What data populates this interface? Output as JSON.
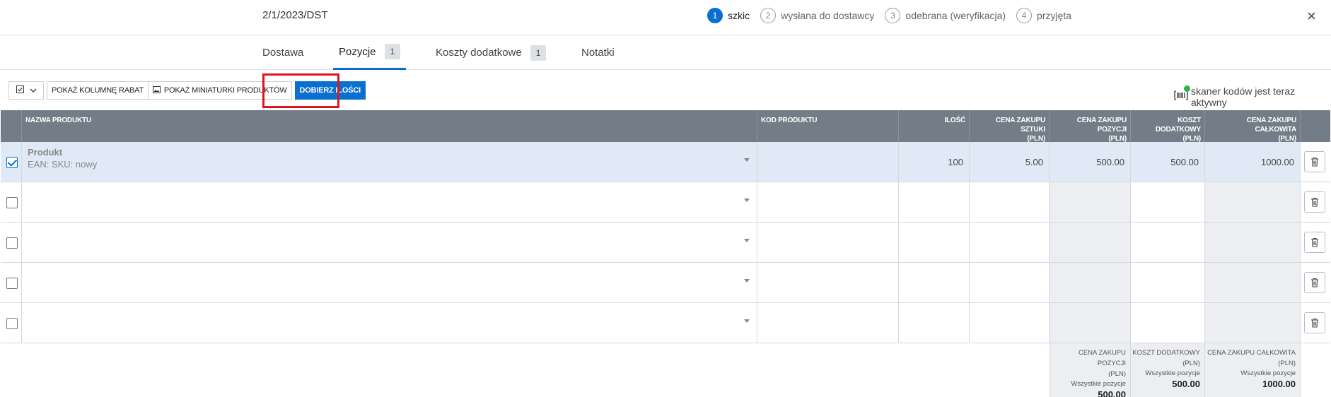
{
  "header": {
    "title": "2/1/2023/DST",
    "steps": [
      {
        "num": "1",
        "label": "szkic"
      },
      {
        "num": "2",
        "label": "wysłana do dostawcy"
      },
      {
        "num": "3",
        "label": "odebrana (weryfikacja)"
      },
      {
        "num": "4",
        "label": "przyjęta"
      }
    ],
    "active_step": "1",
    "close": "×"
  },
  "tabs": [
    {
      "label": "Dostawa",
      "badge": ""
    },
    {
      "label": "Pozycje",
      "badge": "1"
    },
    {
      "label": "Koszty dodatkowe",
      "badge": "1"
    },
    {
      "label": "Notatki",
      "badge": ""
    }
  ],
  "active_tab": "Pozycje",
  "toolbar": {
    "show_discount": "POKAŻ KOLUMNĘ RABAT",
    "show_thumbnails": "POKAŻ MINIATURKI PRODUKTÓW",
    "pick_quantities": "DOBIERZ ILOŚCI",
    "scanner_status": "skaner kodów jest teraz aktywny"
  },
  "columns": {
    "name": "NAZWA PRODUKTU",
    "code": "KOD PRODUKTU",
    "qty": "ILOŚĆ",
    "unit_price_1": "CENA ZAKUPU SZTUKI",
    "unit_price_2": "(PLN)",
    "pos_price_1": "CENA ZAKUPU POZYCJI",
    "pos_price_2": "(PLN)",
    "extra_1": "KOSZT DODATKOWY",
    "extra_2": "(PLN)",
    "total_1": "CENA ZAKUPU CAŁKOWITA",
    "total_2": "(PLN)"
  },
  "rows": [
    {
      "checked": true,
      "name": "Produkt",
      "meta": "EAN:  SKU: nowy",
      "code": "",
      "qty": "100",
      "unit_price": "5.00",
      "pos_price": "500.00",
      "extra": "500.00",
      "total": "1000.00"
    },
    {
      "checked": false,
      "name": "",
      "meta": "",
      "code": "",
      "qty": "",
      "unit_price": "",
      "pos_price": "",
      "extra": "",
      "total": ""
    },
    {
      "checked": false,
      "name": "",
      "meta": "",
      "code": "",
      "qty": "",
      "unit_price": "",
      "pos_price": "",
      "extra": "",
      "total": ""
    },
    {
      "checked": false,
      "name": "",
      "meta": "",
      "code": "",
      "qty": "",
      "unit_price": "",
      "pos_price": "",
      "extra": "",
      "total": ""
    },
    {
      "checked": false,
      "name": "",
      "meta": "",
      "code": "",
      "qty": "",
      "unit_price": "",
      "pos_price": "",
      "extra": "",
      "total": ""
    }
  ],
  "totals": [
    {
      "h1": "CENA ZAKUPU POZYCJI",
      "h2": "(PLN)",
      "sub": "Wszystkie pozycje",
      "value": "500.00"
    },
    {
      "h1": "KOSZT DODATKOWY",
      "h2": "(PLN)",
      "sub": "Wszystkie pozycje",
      "value": "500.00"
    },
    {
      "h1": "CENA ZAKUPU CAŁKOWITA",
      "h2": "(PLN)",
      "sub": "Wszystkie pozycje",
      "value": "1000.00"
    }
  ],
  "colors": {
    "accent": "#0b6fd1",
    "header_bg": "#737d87",
    "highlight": "#e0141c",
    "selected_row": "#dfeaf6"
  },
  "icons": {
    "dropdown": "checkbox-dropdown-icon",
    "image": "image-icon",
    "scanner": "barcode-scanner-icon",
    "trash": "trash-icon",
    "close": "close-icon"
  }
}
